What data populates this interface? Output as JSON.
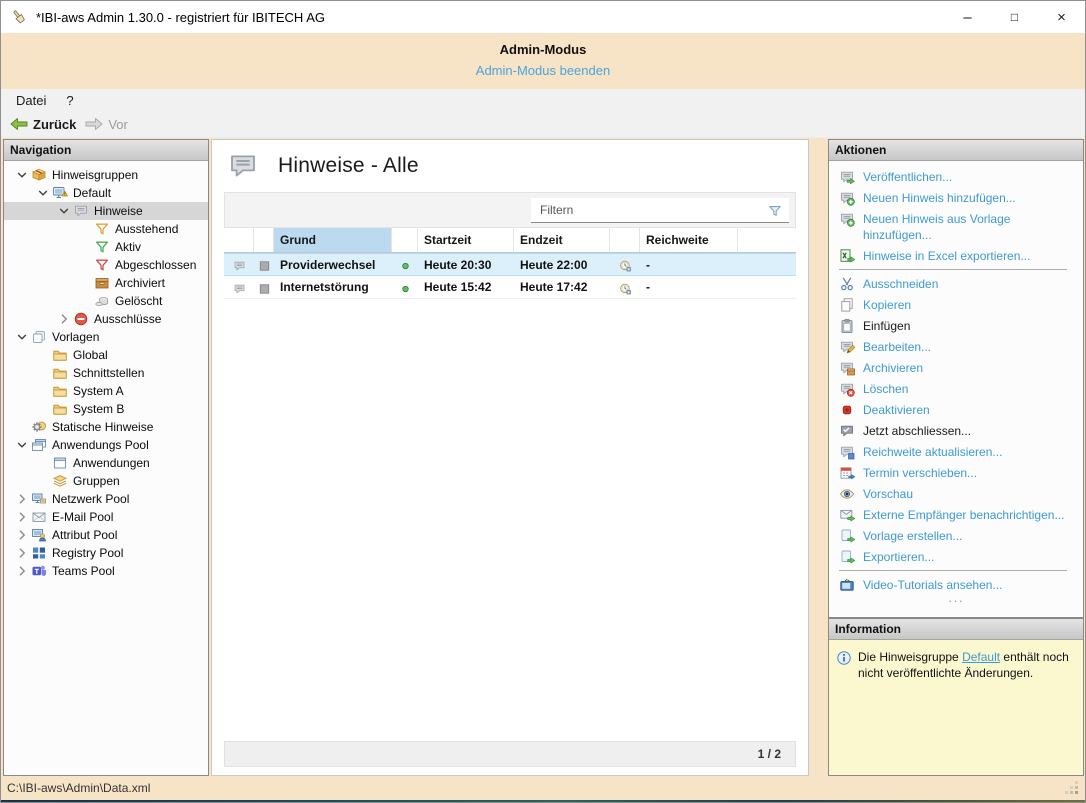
{
  "window": {
    "title": "*IBI-aws Admin 1.30.0 - registriert für IBITECH AG",
    "controls": {
      "minimize": "–",
      "maximize": "□",
      "close": "×"
    }
  },
  "admin_banner": {
    "title": "Admin-Modus",
    "link": "Admin-Modus beenden"
  },
  "menu": {
    "items": [
      "Datei",
      "?"
    ]
  },
  "toolbar": {
    "back": "Zurück",
    "forward": "Vor"
  },
  "navigation": {
    "header": "Navigation",
    "items": [
      {
        "label": "Hinweisgruppen",
        "level": 0,
        "chevron": "expanded",
        "icon": "hint-groups-icon"
      },
      {
        "label": "Default",
        "level": 1,
        "chevron": "expanded",
        "icon": "default-group-icon"
      },
      {
        "label": "Hinweise",
        "level": 2,
        "chevron": "expanded",
        "icon": "hints-bubble-icon",
        "selected": true
      },
      {
        "label": "Ausstehend",
        "level": 3,
        "chevron": "none",
        "icon": "funnel-pending-icon"
      },
      {
        "label": "Aktiv",
        "level": 3,
        "chevron": "none",
        "icon": "funnel-active-icon"
      },
      {
        "label": "Abgeschlossen",
        "level": 3,
        "chevron": "none",
        "icon": "funnel-completed-icon"
      },
      {
        "label": "Archiviert",
        "level": 3,
        "chevron": "none",
        "icon": "archive-box-icon"
      },
      {
        "label": "Gelöscht",
        "level": 3,
        "chevron": "none",
        "icon": "deleted-icon"
      },
      {
        "label": "Ausschlüsse",
        "level": 2,
        "chevron": "collapsed",
        "icon": "exclusions-icon"
      },
      {
        "label": "Vorlagen",
        "level": 0,
        "chevron": "expanded",
        "icon": "templates-icon"
      },
      {
        "label": "Global",
        "level": 1,
        "chevron": "none",
        "icon": "folder-icon"
      },
      {
        "label": "Schnittstellen",
        "level": 1,
        "chevron": "none",
        "icon": "folder-icon"
      },
      {
        "label": "System A",
        "level": 1,
        "chevron": "none",
        "icon": "folder-icon"
      },
      {
        "label": "System B",
        "level": 1,
        "chevron": "none",
        "icon": "folder-icon"
      },
      {
        "label": "Statische Hinweise",
        "level": 0,
        "chevron": "none",
        "icon": "static-hints-icon"
      },
      {
        "label": "Anwendungs Pool",
        "level": 0,
        "chevron": "expanded",
        "icon": "app-pool-icon"
      },
      {
        "label": "Anwendungen",
        "level": 1,
        "chevron": "none",
        "icon": "application-window-icon"
      },
      {
        "label": "Gruppen",
        "level": 1,
        "chevron": "none",
        "icon": "groups-icon"
      },
      {
        "label": "Netzwerk Pool",
        "level": 0,
        "chevron": "collapsed",
        "icon": "network-pool-icon"
      },
      {
        "label": "E-Mail Pool",
        "level": 0,
        "chevron": "collapsed",
        "icon": "email-pool-icon"
      },
      {
        "label": "Attribut Pool",
        "level": 0,
        "chevron": "collapsed",
        "icon": "attribute-pool-icon"
      },
      {
        "label": "Registry Pool",
        "level": 0,
        "chevron": "collapsed",
        "icon": "registry-pool-icon"
      },
      {
        "label": "Teams Pool",
        "level": 0,
        "chevron": "collapsed",
        "icon": "teams-pool-icon"
      }
    ]
  },
  "main": {
    "title": "Hinweise - Alle",
    "filter": {
      "placeholder": "Filtern"
    },
    "table": {
      "columns": [
        "",
        "",
        "Grund",
        "",
        "Startzeit",
        "Endzeit",
        "",
        "Reichweite"
      ],
      "rows": [
        {
          "grund": "Providerwechsel",
          "startzeit": "Heute 20:30",
          "endzeit": "Heute 22:00",
          "reichweite": "-",
          "selected": true
        },
        {
          "grund": "Internetstörung",
          "startzeit": "Heute 15:42",
          "endzeit": "Heute 17:42",
          "reichweite": "-",
          "selected": false
        }
      ]
    },
    "pagination": "1 / 2"
  },
  "actions": {
    "header": "Aktionen",
    "overflow_indicator": "···",
    "items": [
      {
        "label": "Veröffentlichen...",
        "icon": "publish-icon"
      },
      {
        "label": "Neuen Hinweis hinzufügen...",
        "icon": "add-hint-icon"
      },
      {
        "label": "Neuen Hinweis aus Vorlage hinzufügen...",
        "icon": "add-hint-template-icon"
      },
      {
        "label": "Hinweise in Excel exportieren...",
        "icon": "excel-export-icon"
      },
      {
        "label": "Ausschneiden",
        "icon": "cut-icon",
        "sep_before": true
      },
      {
        "label": "Kopieren",
        "icon": "copy-icon"
      },
      {
        "label": "Einfügen",
        "icon": "paste-icon",
        "enabled": false
      },
      {
        "label": "Bearbeiten...",
        "icon": "edit-icon"
      },
      {
        "label": "Archivieren",
        "icon": "archive-action-icon"
      },
      {
        "label": "Löschen",
        "icon": "delete-icon"
      },
      {
        "label": "Deaktivieren",
        "icon": "deactivate-icon"
      },
      {
        "label": "Jetzt abschliessen...",
        "icon": "finish-now-icon",
        "enabled": false
      },
      {
        "label": "Reichweite aktualisieren...",
        "icon": "update-scope-icon"
      },
      {
        "label": "Termin verschieben...",
        "icon": "reschedule-icon"
      },
      {
        "label": "Vorschau",
        "icon": "preview-eye-icon"
      },
      {
        "label": "Externe Empfänger benachrichtigen...",
        "icon": "notify-external-icon"
      },
      {
        "label": "Vorlage erstellen...",
        "icon": "create-template-icon"
      },
      {
        "label": "Exportieren...",
        "icon": "export-icon"
      },
      {
        "label": "Video-Tutorials ansehen...",
        "icon": "video-tutorials-icon",
        "sep_before": true
      }
    ]
  },
  "information": {
    "header": "Information",
    "text_before": "Die Hinweisgruppe ",
    "link": "Default",
    "text_after": " enthält noch nicht veröffentlichte Änderungen."
  },
  "statusbar": {
    "path": "C:\\IBI-aws\\Admin\\Data.xml"
  },
  "colors": {
    "admin_frame": "#F7E4C6",
    "link_blue": "#3E9AD2",
    "selected_row": "#DCF0FB",
    "sorted_column_header": "#BCDAEF",
    "info_background": "#FBF8D0",
    "panel_header": "#C7C7C7",
    "back_arrow_green": "#8BC34A"
  }
}
